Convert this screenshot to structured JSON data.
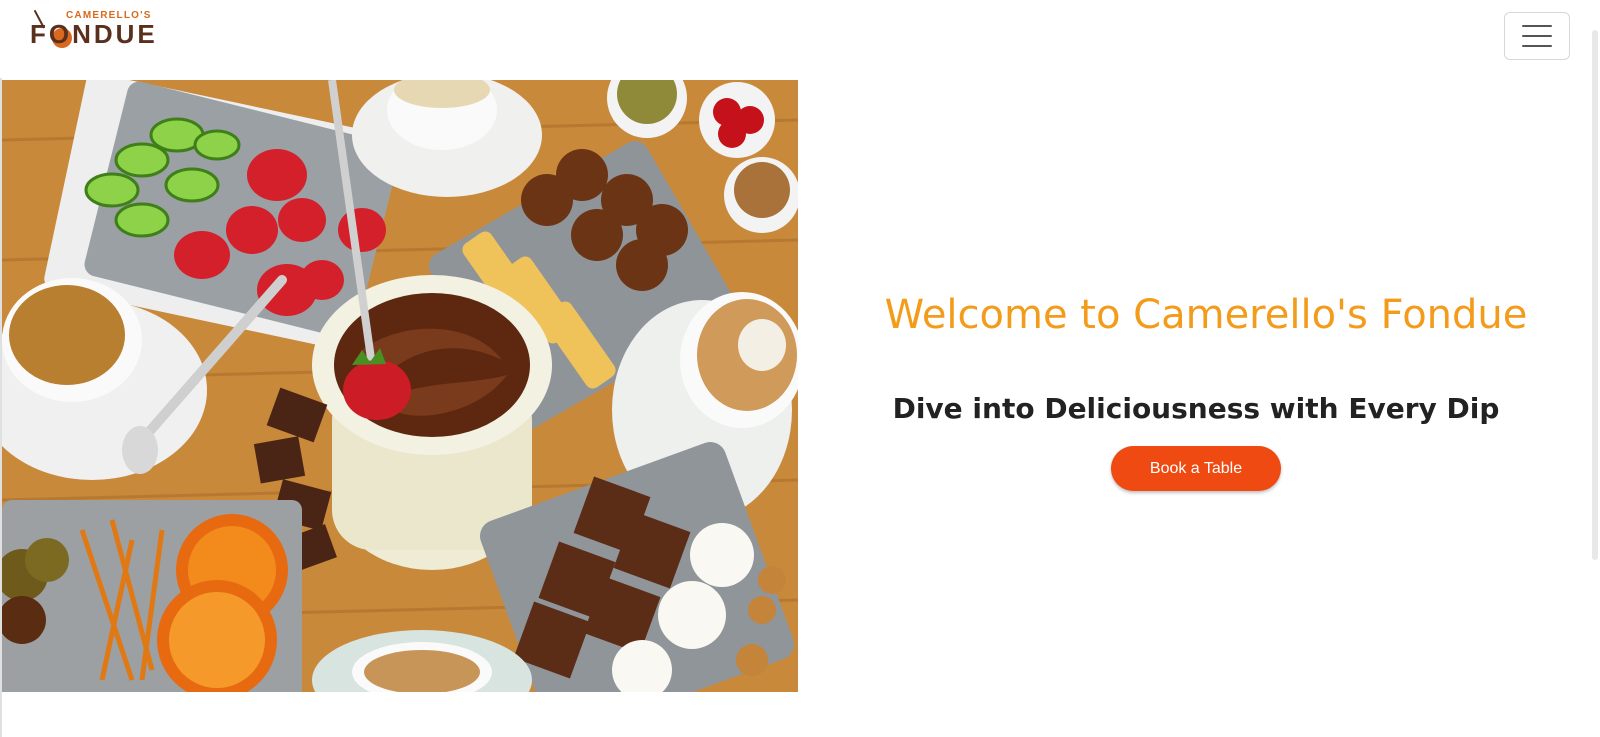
{
  "header": {
    "logo_small": "CAMERELLO'S",
    "logo_big": "FONDUE",
    "menu_icon": "hamburger-menu-icon"
  },
  "hero": {
    "title": "Welcome to Camerello's Fondue",
    "subtitle": "Dive into Deliciousness with Every Dip",
    "cta_label": "Book a Table",
    "image_alt": "fondue-platter-photo"
  },
  "colors": {
    "title": "#f39c1b",
    "cta": "#ef4a12",
    "logo_accent": "#d9691c",
    "logo_dark": "#5b2f1d"
  }
}
